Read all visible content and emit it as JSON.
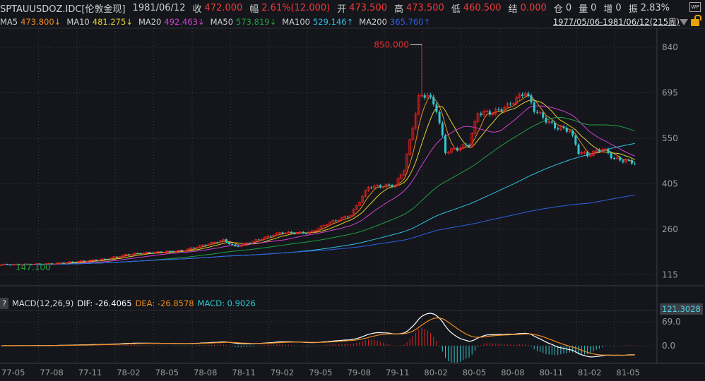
{
  "header": {
    "symbol": "SPTAUUSDOZ.IDC[伦敦金现]",
    "date": "1981/06/12",
    "close_label": "收",
    "close": "472.000",
    "change_label": "幅",
    "change": "2.61%(12.000)",
    "open_label": "开",
    "open": "473.500",
    "high_label": "高",
    "high": "473.500",
    "low_label": "低",
    "low": "460.500",
    "settle_label": "结",
    "settle": "0.000",
    "oi_label": "仓",
    "oi": "0",
    "vol_label": "量",
    "vol": "0",
    "inc_label": "增",
    "inc": "0",
    "amp_label": "振",
    "amp": "2.83%"
  },
  "ma": [
    {
      "label": "MA5",
      "value": "473.800↓",
      "color": "#f08c1e"
    },
    {
      "label": "MA10",
      "value": "481.275↓",
      "color": "#e0d030"
    },
    {
      "label": "MA20",
      "value": "492.463↓",
      "color": "#d040d0"
    },
    {
      "label": "MA50",
      "value": "573.819↓",
      "color": "#20a040"
    },
    {
      "label": "MA100",
      "value": "529.146↑",
      "color": "#30c0e0"
    },
    {
      "label": "MA200",
      "value": "365.760↑",
      "color": "#3060e0"
    }
  ],
  "range_label": "1977/05/06-1981/06/12(215周)",
  "icons": [
    "wp-icon",
    "dropdown-triangle-icon",
    "lock-icon",
    "help-icon"
  ],
  "colors": {
    "up": "#e02020",
    "down": "#30c8d0",
    "dif": "#ffffff",
    "dea": "#f08c1e"
  },
  "macd": {
    "help": "?",
    "title": "MACD(12,26,9)",
    "dif": "DIF: -26.4065",
    "dea": "DEA: -26.8578",
    "macd": "MACD: 0.9026",
    "tag": "121.3028"
  },
  "chart_data": {
    "type": "candlestick",
    "start_date": "1977-05-06",
    "end_date": "1981-06-12",
    "bars": 215,
    "interval": "weekly",
    "close_keypoints": [
      [
        "1977-05-06",
        147
      ],
      [
        "1977-09-02",
        150
      ],
      [
        "1978-01-06",
        165
      ],
      [
        "1978-03-03",
        181
      ],
      [
        "1978-07-07",
        192
      ],
      [
        "1978-10-13",
        226
      ],
      [
        "1978-11-10",
        204
      ],
      [
        "1979-02-23",
        249
      ],
      [
        "1979-05-04",
        249
      ],
      [
        "1979-06-22",
        282
      ],
      [
        "1979-08-10",
        305
      ],
      [
        "1979-09-21",
        395
      ],
      [
        "1979-11-23",
        400
      ],
      [
        "1979-12-14",
        451
      ],
      [
        "1980-01-04",
        586
      ],
      [
        "1980-01-18",
        680
      ],
      [
        "1980-02-08",
        690
      ],
      [
        "1980-02-29",
        642
      ],
      [
        "1980-03-21",
        507
      ],
      [
        "1980-04-18",
        518
      ],
      [
        "1980-05-16",
        530
      ],
      [
        "1980-06-06",
        631
      ],
      [
        "1980-07-11",
        631
      ],
      [
        "1980-08-15",
        653
      ],
      [
        "1980-09-26",
        698
      ],
      [
        "1980-10-17",
        642
      ],
      [
        "1980-11-14",
        608
      ],
      [
        "1980-12-05",
        586
      ],
      [
        "1981-01-09",
        575
      ],
      [
        "1981-01-30",
        507
      ],
      [
        "1981-02-20",
        496
      ],
      [
        "1981-03-27",
        518
      ],
      [
        "1981-04-24",
        485
      ],
      [
        "1981-06-12",
        472
      ]
    ],
    "annotations": {
      "high": "850.000",
      "low": "147.100"
    },
    "y_ticks": [
      "840",
      "695",
      "550",
      "405",
      "260",
      "115"
    ],
    "x_ticks": [
      "77-05",
      "77-08",
      "77-11",
      "78-02",
      "78-05",
      "78-08",
      "78-11",
      "79-02",
      "79-05",
      "79-08",
      "79-11",
      "80-02",
      "80-05",
      "80-08",
      "80-11",
      "81-02",
      "81-05"
    ],
    "macd_ticks": [
      "69.0",
      "0.0"
    ],
    "ma_periods": [
      5,
      10,
      20,
      50,
      100,
      200
    ],
    "grid": true
  }
}
